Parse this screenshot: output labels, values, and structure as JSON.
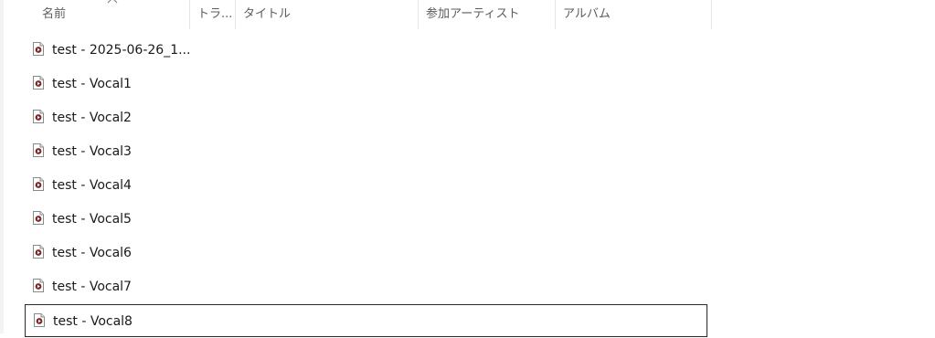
{
  "columns": {
    "name": "名前",
    "track": "トラ...",
    "title": "タイトル",
    "artist": "参加アーティスト",
    "album": "アルバム"
  },
  "files": [
    "test - 2025-06-26_1...",
    "test - Vocal1",
    "test - Vocal2",
    "test - Vocal3",
    "test - Vocal4",
    "test - Vocal5",
    "test - Vocal6",
    "test - Vocal7",
    "test - Vocal8"
  ],
  "icons": {
    "file": "audio-file-icon",
    "sort": "chevron-up-icon"
  }
}
